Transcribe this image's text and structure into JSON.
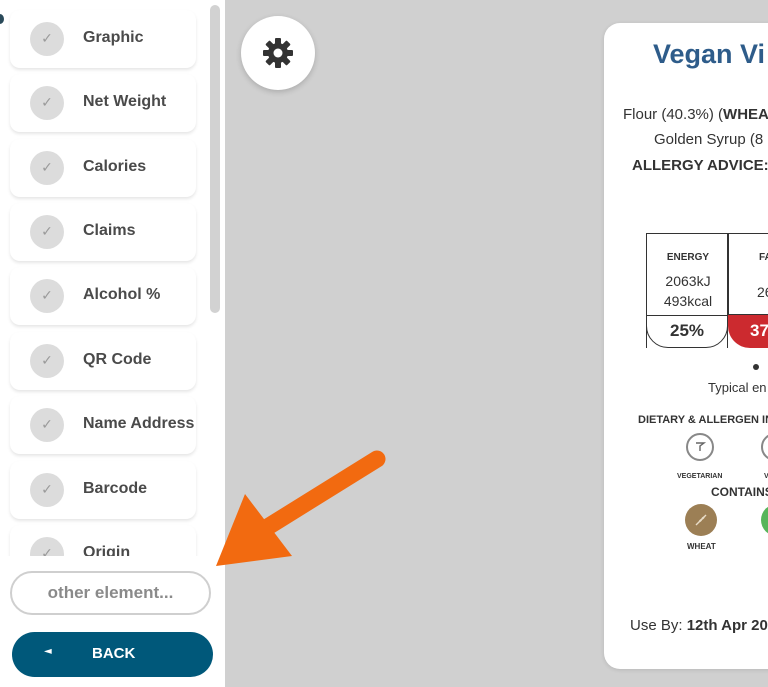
{
  "sidebar": {
    "items": [
      {
        "label": "Graphic",
        "icon": "check-icon"
      },
      {
        "label": "Net Weight",
        "icon": "check-icon"
      },
      {
        "label": "Calories",
        "icon": "check-icon"
      },
      {
        "label": "Claims",
        "icon": "check-icon"
      },
      {
        "label": "Alcohol %",
        "icon": "check-icon"
      },
      {
        "label": "QR Code",
        "icon": "check-icon"
      },
      {
        "label": "Name Address",
        "icon": "check-icon"
      },
      {
        "label": "Barcode",
        "icon": "check-icon"
      },
      {
        "label": "Origin",
        "icon": "check-icon"
      }
    ],
    "check_glyph": "✓",
    "other_placeholder": "other element...",
    "back_arrow": "◄",
    "back_label": "BACK"
  },
  "label": {
    "title": "Vegan Vi",
    "ingredients_line1_prefix": "Flour (40.3%) (",
    "ingredients_line1_bold": "WHEA",
    "ingredients_line2": "Golden Syrup (8",
    "allergy_advice": "ALLERGY ADVICE: I",
    "nutrition": {
      "energy_title": "ENERGY",
      "energy_kj": "2063kJ",
      "energy_kcal": "493kcal",
      "energy_pct": "25%",
      "fat_title": "FA",
      "fat_value": "26",
      "fat_pct": "37"
    },
    "typical_energy": "Typical en",
    "dietary_heading": "DIETARY & ALLERGEN IN",
    "vegetarian_label": "VEGETARIAN",
    "second_diet_label": "V",
    "contains_heading": "CONTAINS",
    "wheat_label": "WHEAT",
    "second_allergen_label": "S",
    "use_by_prefix": "Use By: ",
    "use_by_date": "12th Apr 20"
  },
  "colors": {
    "accent": "#00587a",
    "title": "#2e5c8a",
    "high_red": "#cc2a2f",
    "annotation_orange": "#f26a10",
    "wheat_brown": "#9c7f55",
    "green": "#57b55a"
  }
}
